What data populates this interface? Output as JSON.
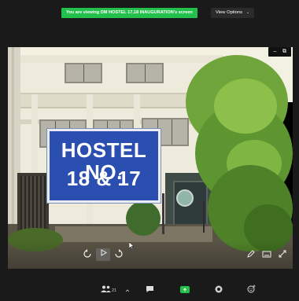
{
  "banner": {
    "text": "You are viewing DM HOSTEL 17,18 INAUGURATION's screen"
  },
  "view_options": {
    "label": "View Options",
    "chevron": "⌄"
  },
  "window_controls": {
    "minimize": "–",
    "restore": "⧉"
  },
  "scene": {
    "sign_line1": "HOSTEL NO.",
    "sign_line2": "18 & 17"
  },
  "video_controls": {
    "icons": [
      "rewind-icon",
      "play-icon",
      "forward-icon",
      "pen-icon",
      "captions-icon",
      "fullscreen-icon"
    ]
  },
  "toolbar": {
    "participants_count": "21",
    "icons": [
      "participants-icon",
      "chevron-up-icon",
      "chat-icon",
      "share-screen-icon",
      "record-icon",
      "reactions-icon"
    ]
  },
  "colors": {
    "banner_green": "#23c04c",
    "sign_blue": "#2a4fb0",
    "app_background": "#1a1a1a"
  }
}
